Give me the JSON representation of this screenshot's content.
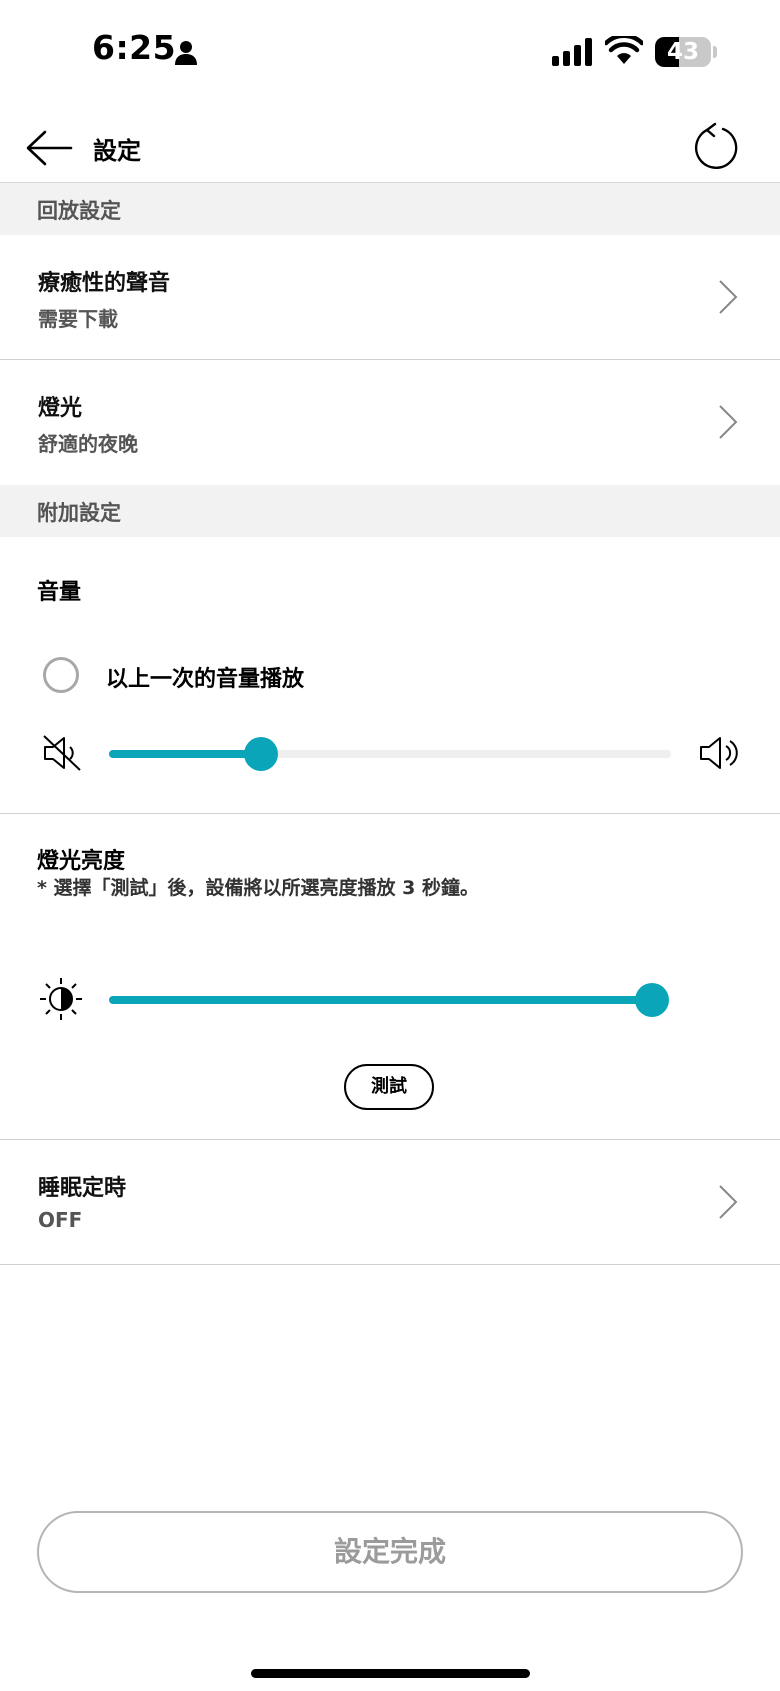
{
  "status_bar": {
    "time": "6:25",
    "battery_level": "43",
    "icons": [
      "person-icon",
      "signal-icon",
      "wifi-icon",
      "battery-icon"
    ]
  },
  "header": {
    "title": "設定",
    "icons": [
      "back-arrow-icon",
      "refresh-icon"
    ]
  },
  "sections": {
    "playback": {
      "header": "回放設定",
      "items": [
        {
          "title": "療癒性的聲音",
          "subtitle": "需要下載"
        },
        {
          "title": "燈光",
          "subtitle": "舒適的夜晚"
        }
      ]
    },
    "additional": {
      "header": "附加設定",
      "volume": {
        "title": "音量",
        "option_label": "以上一次的音量播放",
        "option_checked": false,
        "level_fraction": 0.27
      },
      "brightness": {
        "title": "燈光亮度",
        "note": "* 選擇「測試」後，設備將以所選亮度播放 3 秒鐘。",
        "level_fraction": 0.98,
        "test_label": "測試"
      },
      "sleep_timer": {
        "title": "睡眠定時",
        "value": "OFF"
      }
    }
  },
  "footer": {
    "done_label": "設定完成"
  },
  "colors": {
    "accent": "#0aa5b8",
    "section_bg": "#f2f2f2",
    "divider": "#cfcfcf"
  }
}
